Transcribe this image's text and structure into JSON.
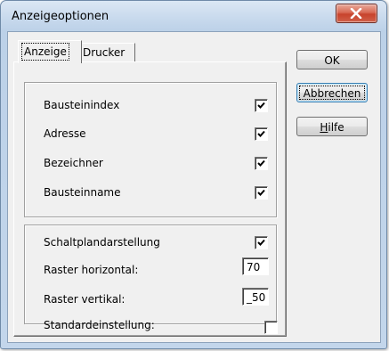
{
  "window": {
    "title": "Anzeigeoptionen"
  },
  "tabs": [
    {
      "label": "Anzeige",
      "selected": true
    },
    {
      "label": "Drucker",
      "selected": false
    }
  ],
  "group1": {
    "options": [
      {
        "label": "Bausteinindex",
        "checked": true
      },
      {
        "label": "Adresse",
        "checked": true
      },
      {
        "label": "Bezeichner",
        "checked": true
      },
      {
        "label": "Bausteinname",
        "checked": true
      }
    ]
  },
  "group2": {
    "schaltplan": {
      "label": "Schaltplandarstellung",
      "checked": true
    },
    "raster_h": {
      "label": "Raster horizontal:",
      "value": "70"
    },
    "raster_v": {
      "label": "Raster vertikal:",
      "value": "_50"
    },
    "standard": {
      "label": "Standardeinstellung:",
      "checked": false
    }
  },
  "buttons": {
    "ok": "OK",
    "abbrechen": "Abbrechen",
    "hilfe_first": "H",
    "hilfe_rest": "ilfe"
  },
  "icons": {
    "close": "close-icon",
    "check": "checkmark-icon"
  }
}
